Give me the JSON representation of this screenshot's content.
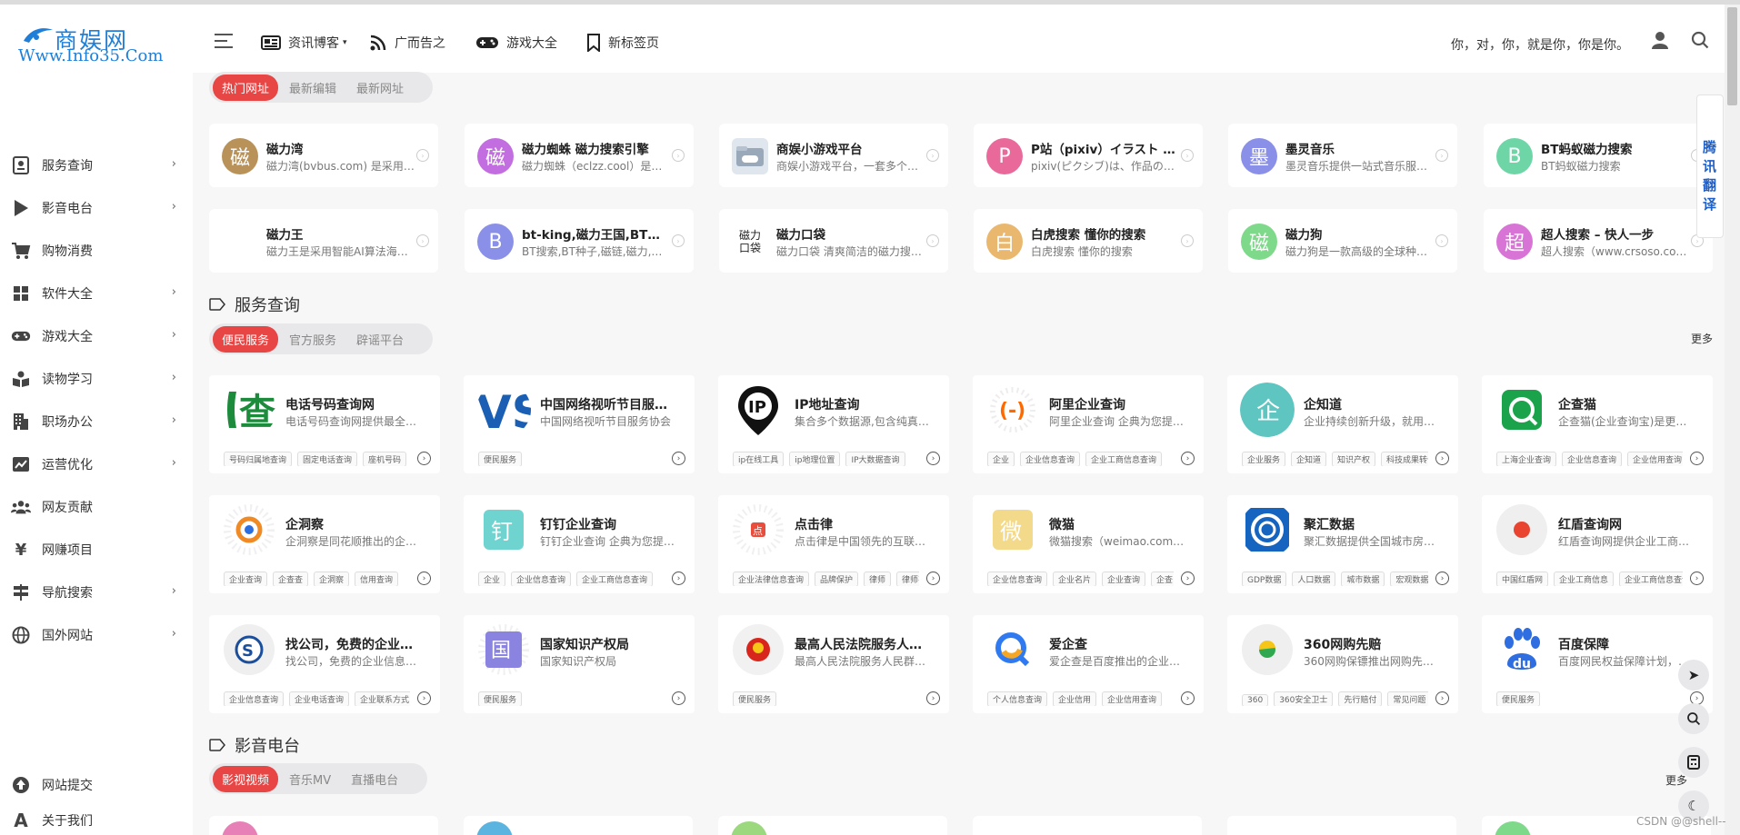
{
  "header": {
    "logo_cn": "商娱网",
    "logo_en": "Www.Info35.Com",
    "nav": [
      {
        "label": "资讯博客",
        "icon": "newspaper-icon",
        "dropdown": true
      },
      {
        "label": "广而告之",
        "icon": "rss-icon"
      },
      {
        "label": "游戏大全",
        "icon": "gamepad-icon"
      },
      {
        "label": "新标签页",
        "icon": "bookmark-icon"
      }
    ],
    "slogan": "你，对，你，就是你，你是你。"
  },
  "sidebar": {
    "items": [
      {
        "label": "服务查询",
        "icon": "service-icon",
        "chevron": true
      },
      {
        "label": "影音电台",
        "icon": "play-icon",
        "chevron": true
      },
      {
        "label": "购物消费",
        "icon": "cart-icon",
        "chevron": false
      },
      {
        "label": "软件大全",
        "icon": "windows-icon",
        "chevron": true
      },
      {
        "label": "游戏大全",
        "icon": "gamepad-icon",
        "chevron": true
      },
      {
        "label": "读物学习",
        "icon": "reading-icon",
        "chevron": true
      },
      {
        "label": "职场办公",
        "icon": "building-icon",
        "chevron": true
      },
      {
        "label": "运营优化",
        "icon": "chart-icon",
        "chevron": true
      },
      {
        "label": "网友贡献",
        "icon": "users-icon",
        "chevron": false
      },
      {
        "label": "网赚项目",
        "icon": "yen-icon",
        "chevron": false
      },
      {
        "label": "导航搜索",
        "icon": "signpost-icon",
        "chevron": true
      },
      {
        "label": "国外网站",
        "icon": "globe-icon",
        "chevron": true
      }
    ],
    "bottom": [
      {
        "label": "网站提交",
        "icon": "upload-icon"
      },
      {
        "label": "关于我们",
        "icon": "font-icon"
      }
    ]
  },
  "top_section": {
    "tabs": [
      "热门网址",
      "最新编辑",
      "最新网址"
    ],
    "cards": [
      {
        "title": "磁力湾",
        "desc": "磁力湾(bvbus.com) 是采用智能AI算法",
        "icon_text": "磁",
        "color": "#b9925a"
      },
      {
        "title": "磁力蜘蛛 磁力搜索引擎",
        "desc": "磁力蜘蛛（eclzz.cool）是全网最大",
        "icon_text": "磁",
        "color": "#c36ee0"
      },
      {
        "title": "商娱小游戏平台",
        "desc": "商娱小游戏平台，一套多个在线小游戏",
        "icon_text": "",
        "color": "#dfe6ee"
      },
      {
        "title": "P站（pixiv）イラスト コミュニケーション",
        "desc": "pixiv(ピクシブ)は、作品の投稿・閲覧",
        "icon_text": "P",
        "color": "#e8699a"
      },
      {
        "title": "墨灵音乐",
        "desc": "墨灵音乐提供一站式音乐服务平台",
        "icon_text": "墨",
        "color": "#8a8fe8"
      },
      {
        "title": "BT蚂蚁磁力搜索",
        "desc": "BT蚂蚁磁力搜索",
        "icon_text": "B",
        "color": "#6ed6a6"
      },
      {
        "title": "磁力王",
        "desc": "磁力王是采用智能AI算法海量资源搜索",
        "icon_text": "",
        "color": "#ffffff"
      },
      {
        "title": "bt-king,磁力王国,BT搜索引擎",
        "desc": "BT搜索,BT种子,磁链,磁力,下载",
        "icon_text": "B",
        "color": "#8a8fe8"
      },
      {
        "title": "磁力口袋",
        "desc": "磁力口袋 清爽简洁的磁力搜索引擎",
        "icon_text": "磁力\n口袋",
        "color": "#ffffff"
      },
      {
        "title": "白虎搜索 懂你的搜索",
        "desc": "白虎搜索 懂你的搜索",
        "icon_text": "白",
        "color": "#e9b86e"
      },
      {
        "title": "磁力狗",
        "desc": "磁力狗是一款高级的全球种子搜索引擎",
        "icon_text": "磁",
        "color": "#7ed98a"
      },
      {
        "title": "超人搜索 – 快人一步",
        "desc": "超人搜索（www.crsoso.com）",
        "icon_text": "超",
        "color": "#d874d6"
      }
    ]
  },
  "service_section": {
    "title": "服务查询",
    "tabs": [
      "便民服务",
      "官方服务",
      "辟谣平台"
    ],
    "more": "更多",
    "cards": [
      {
        "title": "电话号码查询网",
        "desc": "电话号码查询网提供最全面的号码查询",
        "tags": [
          "号码归属地查询",
          "固定电话查询",
          "座机号码"
        ],
        "logo": "phone-query-logo"
      },
      {
        "title": "中国网络视听节目服务协会",
        "desc": "中国网络视听节目服务协会",
        "tags": [
          "便民服务"
        ],
        "logo": "cnsa-logo"
      },
      {
        "title": "IP地址查询",
        "desc": "集合多个数据源,包含纯真数据库",
        "tags": [
          "ip在线工具",
          "ip地理位置",
          "IP大数据查询"
        ],
        "logo": "ip-pin-logo"
      },
      {
        "title": "阿里企业查询",
        "desc": "阿里企业查询 企典为您提供企业信息",
        "tags": [
          "企业",
          "企业信息查询",
          "企业工商信息查询"
        ],
        "logo": "aliyun-logo"
      },
      {
        "title": "企知道",
        "desc": "企业持续创新升级，就用企知道",
        "tags": [
          "企业服务",
          "企知道",
          "知识产权",
          "科技成果转化"
        ],
        "logo": "qizhidao-logo"
      },
      {
        "title": "企查猫",
        "desc": "企查猫(企业查询宝)是更好用的企业查询",
        "tags": [
          "上海企业查询",
          "企业信息查询",
          "企业信用查询"
        ],
        "logo": "qichamao-logo"
      },
      {
        "title": "企洞察",
        "desc": "企洞察是同花顺推出的企业信息查询",
        "tags": [
          "企业查询",
          "企查查",
          "企洞察",
          "信用查询"
        ],
        "logo": "qidongcha-logo"
      },
      {
        "title": "钉钉企业查询",
        "desc": "钉钉企业查询 企典为您提供企业信息",
        "tags": [
          "企业",
          "企业信息查询",
          "企业工商信息查询"
        ],
        "logo": "dingtalk-logo"
      },
      {
        "title": "点击律",
        "desc": "点击律是中国领先的互联网法律服务",
        "tags": [
          "企业法律信息查询",
          "品牌保护",
          "律师",
          "律师事务所"
        ],
        "logo": "dianjilv-logo"
      },
      {
        "title": "微猫",
        "desc": "微猫搜索（weimao.com）企业信息",
        "tags": [
          "企业信息查询",
          "企业名片",
          "企业查询",
          "企查"
        ],
        "logo": "weimao-logo"
      },
      {
        "title": "聚汇数据",
        "desc": "聚汇数据提供全国城市房价数据",
        "tags": [
          "GDP数据",
          "人口数据",
          "城市数据",
          "宏观数据"
        ],
        "logo": "juhui-logo"
      },
      {
        "title": "红盾查询网",
        "desc": "红盾查询网提供企业工商信息查询",
        "tags": [
          "中国红盾网",
          "企业工商信息",
          "企业工商信息查询"
        ],
        "logo": "hongdun-logo"
      },
      {
        "title": "找公司，免费的企业信息查询",
        "desc": "找公司，免费的企业信息查询平台",
        "tags": [
          "企业信息查询",
          "企业电话查询",
          "企业联系方式"
        ],
        "logo": "zhaogongsi-logo"
      },
      {
        "title": "国家知识产权局",
        "desc": "国家知识产权局",
        "tags": [
          "便民服务"
        ],
        "logo": "cnipa-logo"
      },
      {
        "title": "最高人民法院服务人民群众系统",
        "desc": "最高人民法院服务人民群众系统",
        "tags": [
          "便民服务"
        ],
        "logo": "court-logo"
      },
      {
        "title": "爱企查",
        "desc": "爱企查是百度推出的企业信息查询平台",
        "tags": [
          "个人信息查询",
          "企业信用",
          "企业信用查询"
        ],
        "logo": "aiqicha-logo"
      },
      {
        "title": "360网购先赔",
        "desc": "360网购保镖推出网购先赔服务",
        "tags": [
          "360",
          "360安全卫士",
          "先行赔付",
          "常见问题"
        ],
        "logo": "360-logo"
      },
      {
        "title": "百度保障",
        "desc": "百度网民权益保障计划，为网民保驾护航",
        "tags": [
          "便民服务"
        ],
        "logo": "baidu-logo"
      }
    ]
  },
  "media_section": {
    "title": "影音电台",
    "tabs": [
      "影视视频",
      "音乐MV",
      "直播电台"
    ],
    "more": "更多"
  },
  "floating": {
    "translate": "腾讯翻译",
    "buttons": [
      "back-to-top-icon",
      "search-icon",
      "calculator-icon",
      "moon-icon"
    ]
  },
  "watermark": "CSDN @@shell--"
}
